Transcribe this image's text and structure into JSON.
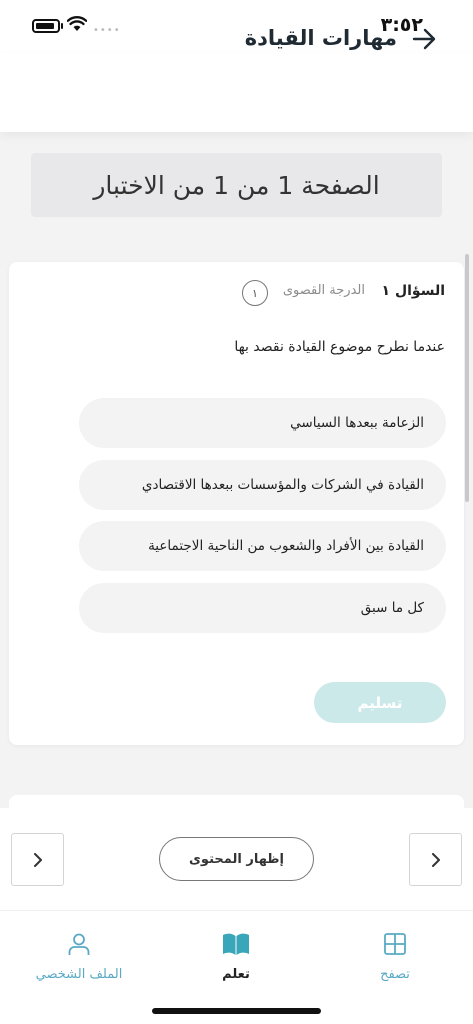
{
  "status_bar": {
    "time": "٣:٥٢"
  },
  "header": {
    "title": "مهارات القيادة"
  },
  "page_indicator": "الصفحة 1 من 1 من الاختبار",
  "question": {
    "label": "السؤال ١",
    "max_grade_label": "الدرجة القصوى",
    "max_grade_value": "١",
    "text": "عندما نطرح موضوع القيادة نقصد بها",
    "options": [
      "الزعامة ببعدها السياسي",
      "القيادة في الشركات والمؤسسات ببعدها الاقتصادي",
      "القيادة بين الأفراد والشعوب من الناحية الاجتماعية",
      "كل ما سبق"
    ],
    "submit_label": "تسليم"
  },
  "navigation": {
    "show_content_label": "إظهار المحتوى"
  },
  "tab_bar": {
    "items": [
      {
        "label": "الملف الشخصي",
        "icon": "profile-icon"
      },
      {
        "label": "تعلم",
        "icon": "book-icon",
        "active": true
      },
      {
        "label": "تصفح",
        "icon": "grid-icon"
      }
    ]
  },
  "colors": {
    "accent": "#5aa9c4",
    "submit_disabled": "#cbe9e8",
    "background": "#f3f3f4"
  }
}
